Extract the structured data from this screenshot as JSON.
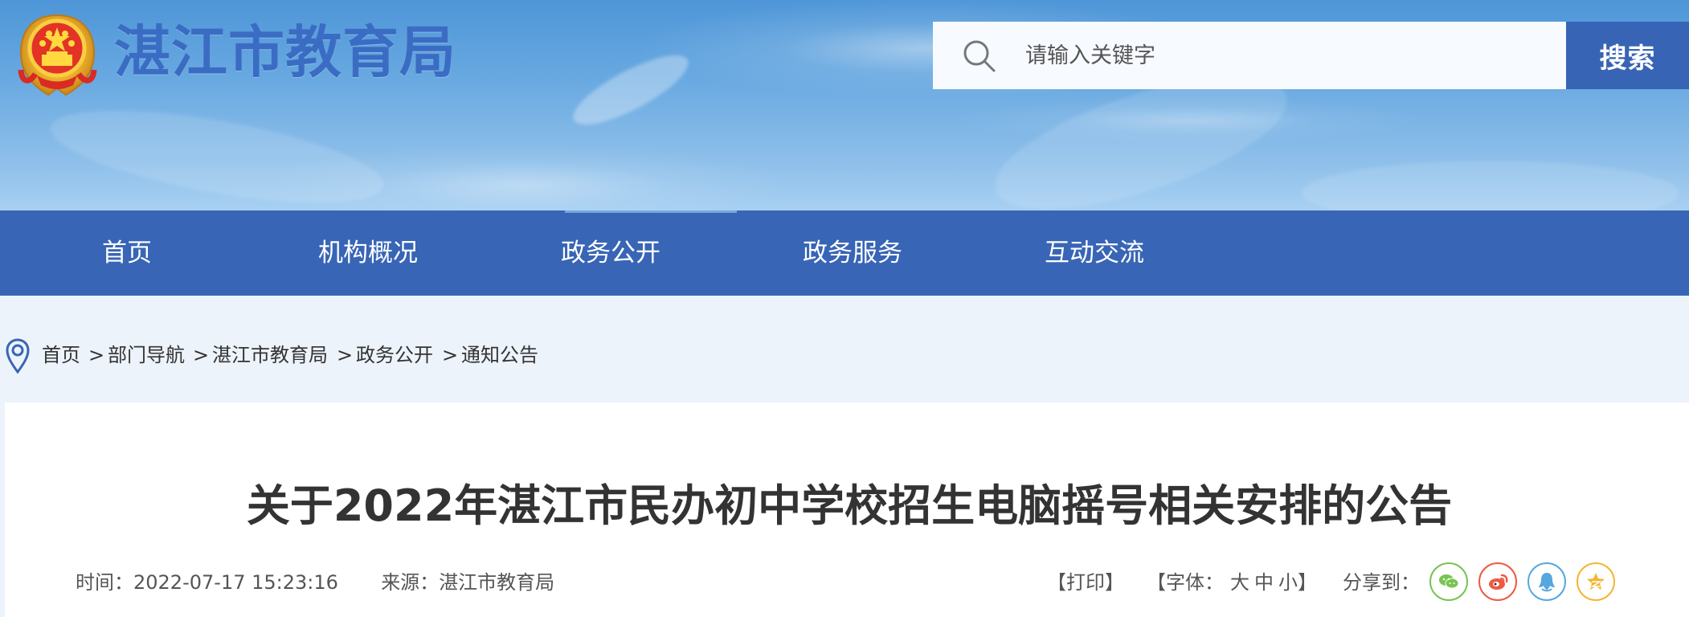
{
  "header": {
    "site_title": "湛江市教育局",
    "search": {
      "placeholder": "请输入关键字",
      "button": "搜索"
    }
  },
  "nav": {
    "items": [
      {
        "label": "首页"
      },
      {
        "label": "机构概况"
      },
      {
        "label": "政务公开"
      },
      {
        "label": "政务服务"
      },
      {
        "label": "互动交流"
      }
    ]
  },
  "breadcrumb": {
    "items": [
      {
        "label": "首页"
      },
      {
        "label": "部门导航"
      },
      {
        "label": "湛江市教育局"
      },
      {
        "label": "政务公开"
      },
      {
        "label": "通知公告"
      }
    ],
    "separator": ">"
  },
  "article": {
    "title": "关于2022年湛江市民办初中学校招生电脑摇号相关安排的公告",
    "time_label": "时间：",
    "time": "2022-07-17 15:23:16",
    "source_label": "来源：",
    "source": "湛江市教育局",
    "print": "【打印】",
    "font_prefix": "【字体：",
    "font_large": "大",
    "font_medium": "中",
    "font_small": "小",
    "font_suffix": "】",
    "share_label": "分享到："
  },
  "icons": {
    "emblem": "national-emblem-icon",
    "search": "search-icon",
    "location": "location-pin-icon",
    "share": [
      "wechat-icon",
      "weibo-icon",
      "qq-icon",
      "qzone-icon"
    ]
  },
  "colors": {
    "brand_blue": "#3865b6",
    "title_blue": "#3b6cc3",
    "wechat": "#78c452",
    "weibo": "#ee5a42",
    "qq": "#55a7de",
    "qzone": "#f4b532"
  }
}
